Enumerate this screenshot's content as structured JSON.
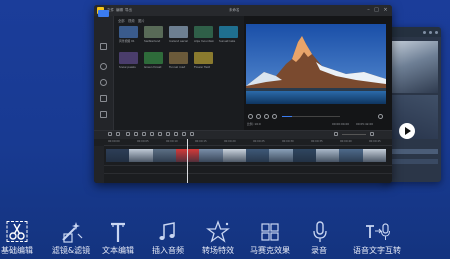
{
  "window": {
    "title": "未命名",
    "menu": [
      "文件",
      "编辑",
      "导出"
    ],
    "controls": [
      "minimize-icon",
      "maximize-icon",
      "close-icon"
    ]
  },
  "media_panel": {
    "tabs": [
      "全部",
      "视频",
      "图片"
    ],
    "thumbs": [
      {
        "label": "风景视频 01",
        "color": "#3a5b8c"
      },
      {
        "label": "Switzerland",
        "color": "#586a57"
      },
      {
        "label": "Iceland aerial",
        "color": "#6d7f91"
      },
      {
        "label": "Alps mountain",
        "color": "#2f5f48"
      },
      {
        "label": "Sunset lake",
        "color": "#1f6f8f"
      },
      {
        "label": "Snow peaks",
        "color": "#4a3d6b"
      },
      {
        "label": "Green forest",
        "color": "#2e6b3a"
      },
      {
        "label": "Tunnel road",
        "color": "#6b5a3a"
      },
      {
        "label": "Flower field",
        "color": "#8a7a2e"
      }
    ]
  },
  "preview": {
    "current_time": "00:00:00.00",
    "duration": "00:05:42.00",
    "ratio_label": "比例: 16:9"
  },
  "timeline": {
    "ruler": [
      "00:00:00",
      "00:00:05",
      "00:00:10",
      "00:00:15",
      "00:00:20",
      "00:00:25",
      "00:00:30",
      "00:00:35",
      "00:00:40",
      "00:00:45"
    ],
    "clips": [
      "#2d3e57",
      "#bfc9d6",
      "#5c6f85",
      "#d43a3a",
      "#7a8ea8",
      "#c9d2dc",
      "#3f5978",
      "#8aa0b8",
      "#2f4660",
      "#a9b8c9",
      "#4e6a8b",
      "#c4ced9"
    ]
  },
  "features": [
    {
      "label": "基础编辑",
      "icon": "scissors-icon",
      "active": true
    },
    {
      "label": "滤镜&滤镜",
      "icon": "magic-wand-icon",
      "active": false
    },
    {
      "label": "文本编辑",
      "icon": "text-icon",
      "active": false
    },
    {
      "label": "插入音频",
      "icon": "music-icon",
      "active": false
    },
    {
      "label": "转场特效",
      "icon": "star-icon",
      "active": false
    },
    {
      "label": "马赛克效果",
      "icon": "mosaic-icon",
      "active": false
    },
    {
      "label": "录音",
      "icon": "microphone-icon",
      "active": false
    },
    {
      "label": "语音文字互转",
      "icon": "speech-to-text-icon",
      "active": false
    }
  ]
}
